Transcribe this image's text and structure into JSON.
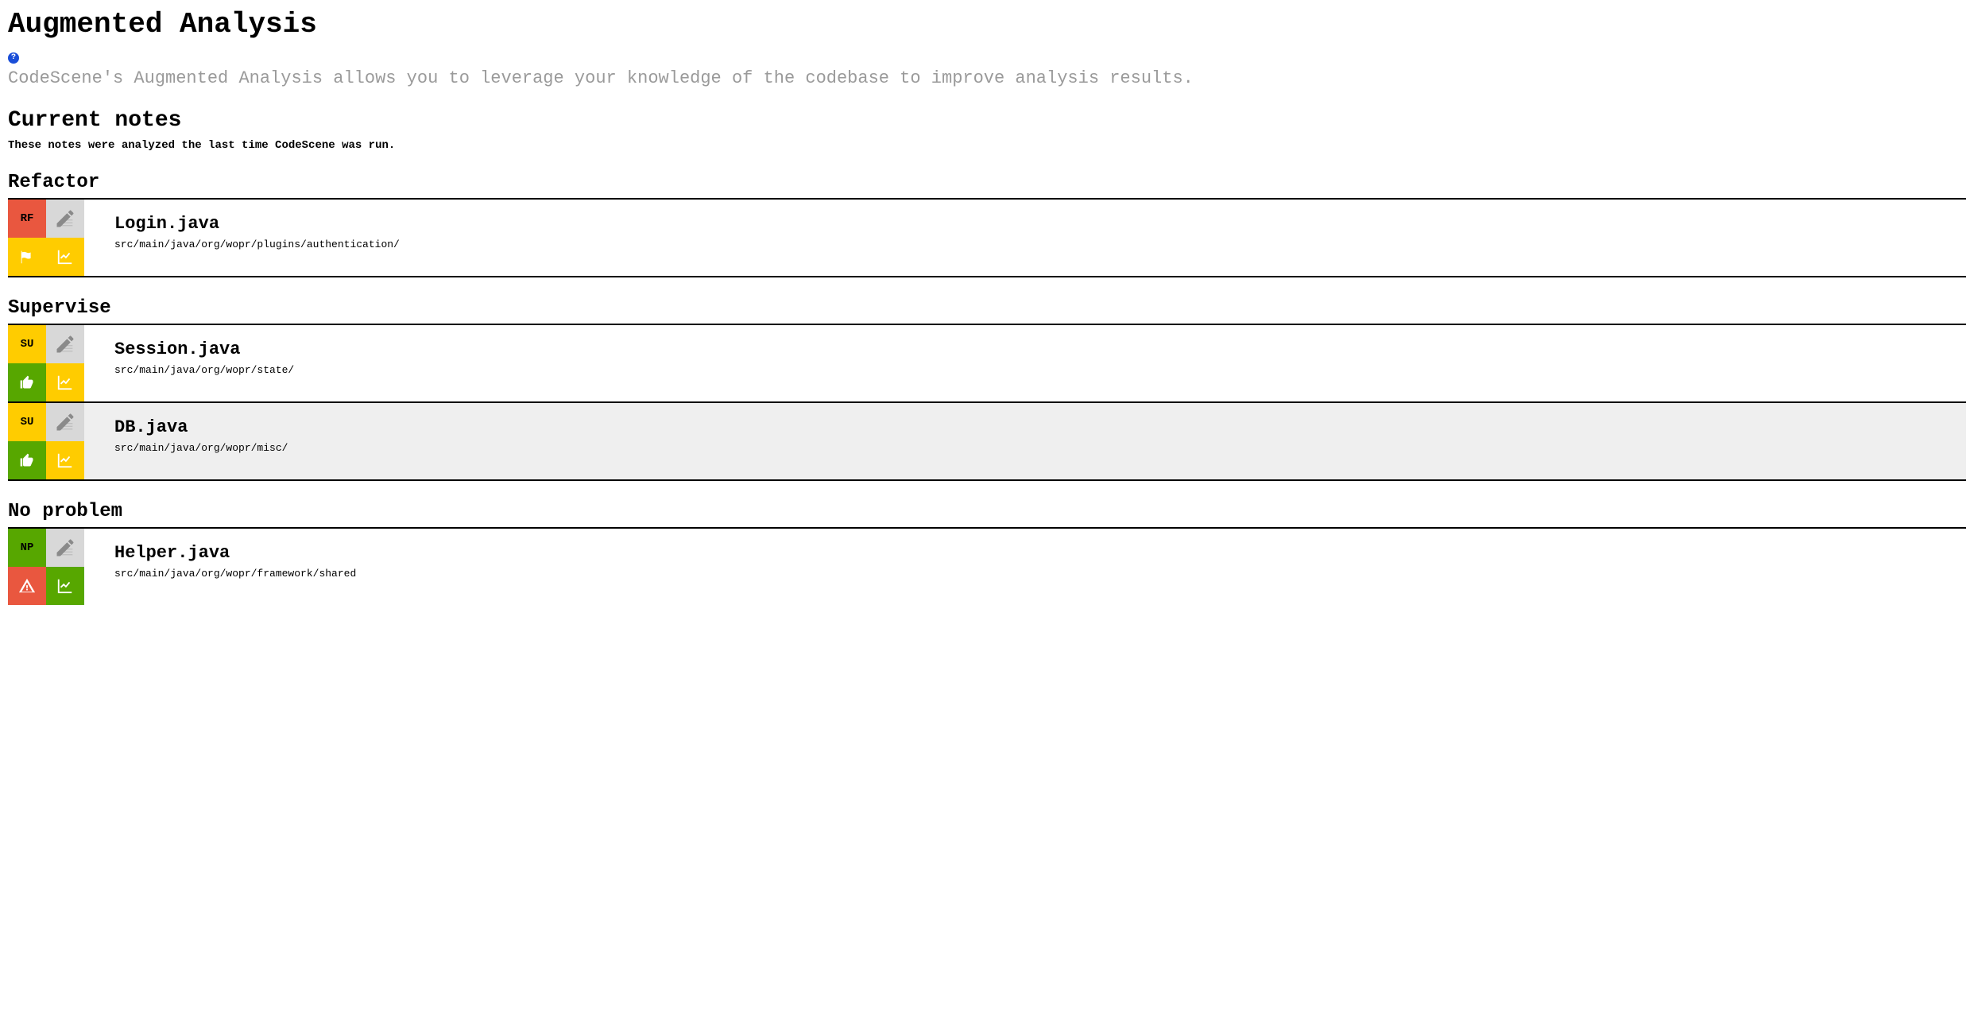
{
  "page": {
    "title": "Augmented Analysis",
    "description": "CodeScene's Augmented Analysis allows you to leverage your knowledge of the codebase to improve analysis results.",
    "subtitle": "Current notes",
    "subtext": "These notes were analyzed the last time CodeScene was run."
  },
  "sections": {
    "refactor": {
      "heading": "Refactor",
      "badge": "RF",
      "items": [
        {
          "name": "Login.java",
          "path": "src/main/java/org/wopr/plugins/authentication/"
        }
      ]
    },
    "supervise": {
      "heading": "Supervise",
      "badge": "SU",
      "items": [
        {
          "name": "Session.java",
          "path": "src/main/java/org/wopr/state/"
        },
        {
          "name": "DB.java",
          "path": "src/main/java/org/wopr/misc/"
        }
      ]
    },
    "noproblem": {
      "heading": "No problem",
      "badge": "NP",
      "items": [
        {
          "name": "Helper.java",
          "path": "src/main/java/org/wopr/framework/shared"
        }
      ]
    }
  }
}
